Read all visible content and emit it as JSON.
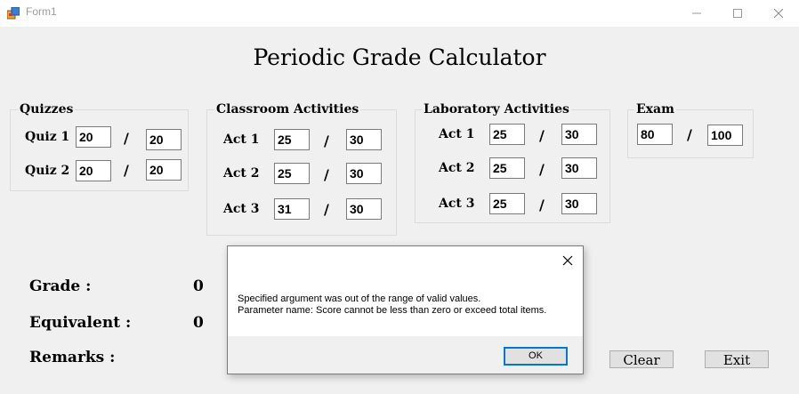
{
  "window": {
    "title": "Form1"
  },
  "header": {
    "title": "Periodic Grade Calculator"
  },
  "quizzes": {
    "label": "Quizzes",
    "rows": [
      {
        "label": "Quiz 1",
        "score": "20",
        "total": "20"
      },
      {
        "label": "Quiz 2",
        "score": "20",
        "total": "20"
      }
    ]
  },
  "classroom": {
    "label": "Classroom Activities",
    "rows": [
      {
        "label": "Act 1",
        "score": "25",
        "total": "30"
      },
      {
        "label": "Act 2",
        "score": "25",
        "total": "30"
      },
      {
        "label": "Act 3",
        "score": "31",
        "total": "30"
      }
    ]
  },
  "laboratory": {
    "label": "Laboratory Activities",
    "rows": [
      {
        "label": "Act 1",
        "score": "25",
        "total": "30"
      },
      {
        "label": "Act 2",
        "score": "25",
        "total": "30"
      },
      {
        "label": "Act 3",
        "score": "25",
        "total": "30"
      }
    ]
  },
  "exam": {
    "label": "Exam",
    "score": "80",
    "total": "100"
  },
  "separator": "/",
  "results": {
    "grade_label": "Grade :",
    "grade_value": "0",
    "equivalent_label": "Equivalent :",
    "equivalent_value": "0",
    "remarks_label": "Remarks :",
    "remarks_value": ""
  },
  "buttons": {
    "clear": "Clear",
    "exit": "Exit"
  },
  "dialog": {
    "line1": "Specified argument was out of the range of valid values.",
    "line2": "Parameter name: Score cannot be less than zero or exceed total items.",
    "ok": "OK"
  }
}
